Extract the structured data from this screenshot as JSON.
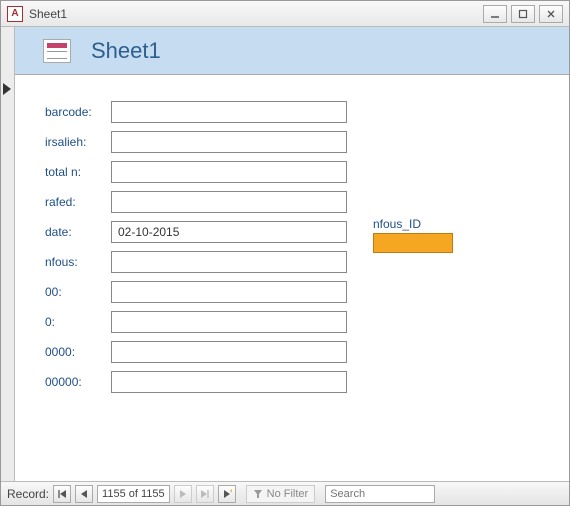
{
  "window": {
    "app_icon_letter": "A",
    "title": "Sheet1"
  },
  "form": {
    "header_title": "Sheet1",
    "fields": [
      {
        "label": "barcode:",
        "value": ""
      },
      {
        "label": "irsalieh:",
        "value": ""
      },
      {
        "label": "total n:",
        "value": ""
      },
      {
        "label": "rafed:",
        "value": ""
      },
      {
        "label": "date:",
        "value": "02-10-2015"
      },
      {
        "label": "nfous:",
        "value": ""
      },
      {
        "label": "00:",
        "value": ""
      },
      {
        "label": "0:",
        "value": ""
      },
      {
        "label": "0000:",
        "value": ""
      },
      {
        "label": "00000:",
        "value": ""
      }
    ],
    "nfous_id": {
      "label": "nfous_ID",
      "value": ""
    }
  },
  "status": {
    "record_label": "Record:",
    "position": "1155 of 1155",
    "filter_label": "No Filter",
    "search_placeholder": "Search"
  }
}
